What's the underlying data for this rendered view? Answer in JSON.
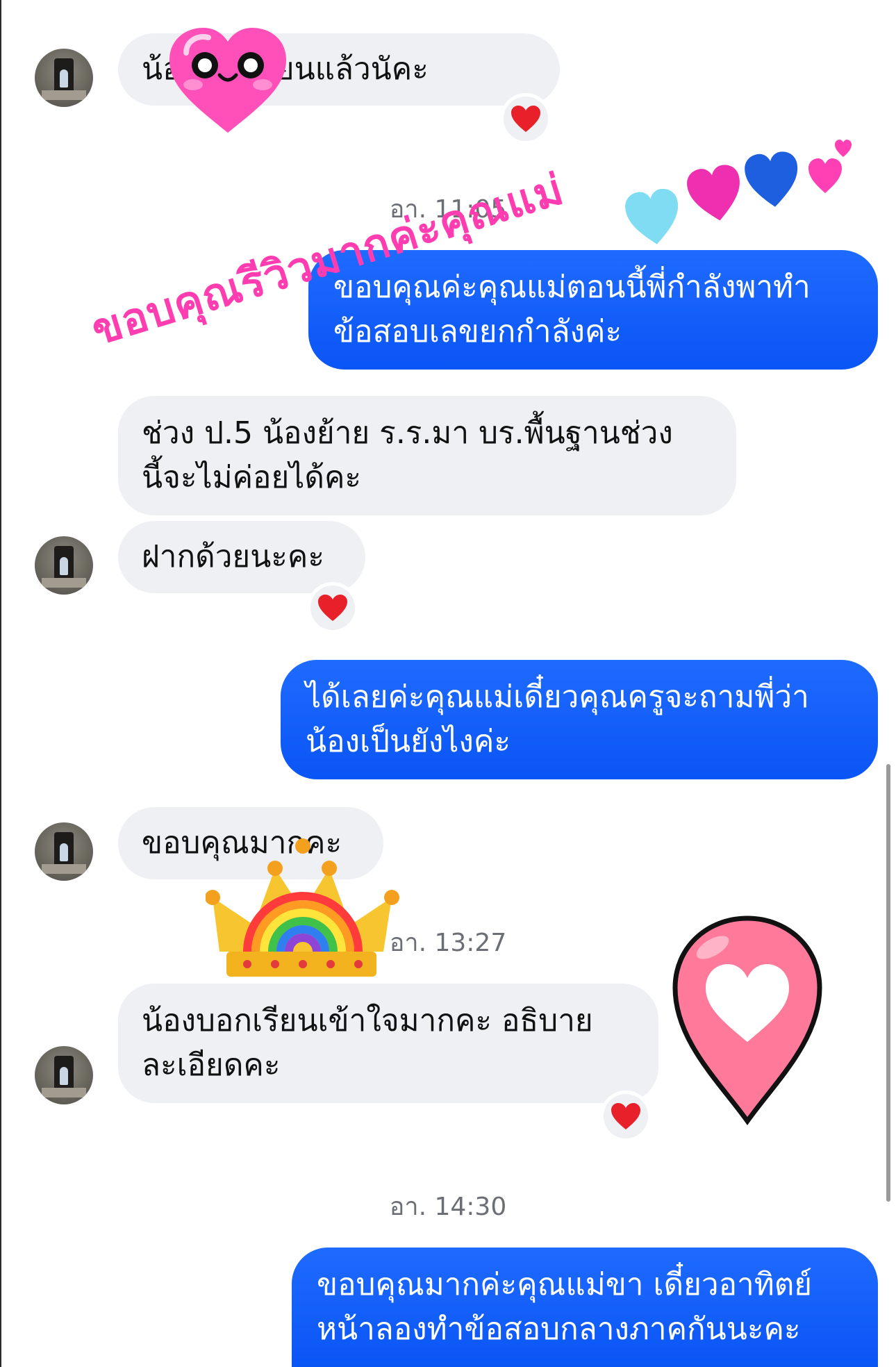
{
  "messages": [
    {
      "side": "in",
      "text": "น้องถึงที่เรียนแล้วนัคะ"
    },
    {
      "side": "out",
      "lines": [
        "ขอบคุณค่ะคุณแม่ตอนนี้พี่กำลังพาทำ",
        "ข้อสอบเลขยกกำลังค่ะ"
      ]
    },
    {
      "side": "in",
      "lines": [
        "ช่วง ป.5 น้องย้าย ร.ร.มา บร.พื้นฐานช่วง",
        "นี้จะไม่ค่อยได้คะ"
      ]
    },
    {
      "side": "in",
      "text": "ฝากด้วยนะคะ"
    },
    {
      "side": "out",
      "lines": [
        "ได้เลยค่ะคุณแม่เดี๋ยวคุณครูจะถามพี่ว่า",
        "น้องเป็นยังไงค่ะ"
      ]
    },
    {
      "side": "in",
      "text": "ขอบคุณมากคะ"
    },
    {
      "side": "in",
      "lines": [
        "น้องบอกเรียนเข้าใจมากคะ อธิบาย",
        "ละเอียดคะ"
      ]
    },
    {
      "side": "out",
      "lines": [
        "ขอบคุณมากค่ะคุณแม่ขา เดี๋ยวอาทิตย์",
        "หน้าลองทำข้อสอบกลางภาคกันนะคะ"
      ]
    }
  ],
  "timestamps": [
    "อา. 11:05",
    "อา. 13:27",
    "อา. 14:30"
  ],
  "overlay_caption": "ขอบคุณรีวิวมากค่ะคุณแม่",
  "reaction_emoji": "❤️",
  "colors": {
    "outgoing": "#0a55f5",
    "incoming": "#eef0f3",
    "overlay": "#ff3db0",
    "reaction": "#e8202a"
  },
  "icons": [
    "heart-reaction-icon",
    "avatar-icon",
    "heart-face-sticker",
    "crown-sticker",
    "heart-pin-sticker",
    "floating-hearts-sticker"
  ]
}
